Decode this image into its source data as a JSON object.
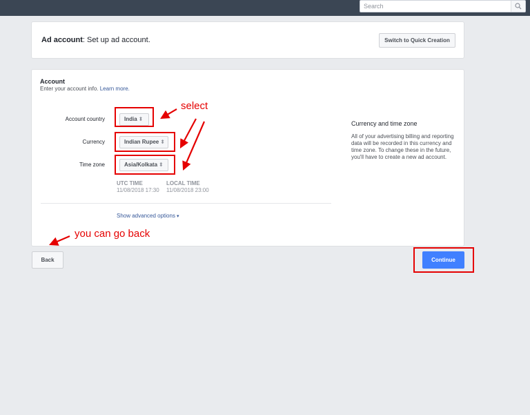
{
  "search": {
    "placeholder": "Search"
  },
  "header": {
    "title_bold": "Ad account",
    "title_rest": ": Set up ad account.",
    "quick_creation_label": "Switch to Quick Creation"
  },
  "account": {
    "title": "Account",
    "subtitle": "Enter your account info.",
    "learn_more": "Learn more.",
    "fields": {
      "country": {
        "label": "Account country",
        "value": "India"
      },
      "currency": {
        "label": "Currency",
        "value": "Indian Rupee"
      },
      "timezone": {
        "label": "Time zone",
        "value": "Asia/Kolkata"
      }
    },
    "utc": {
      "label": "UTC TIME",
      "value": "11/08/2018 17:30"
    },
    "local": {
      "label": "LOCAL TIME",
      "value": "11/08/2018 23:00"
    },
    "advanced_label": "Show advanced options",
    "side_title": "Currency and time zone",
    "side_text": "All of your advertising billing and reporting data will be recorded in this currency and time zone. To change these in the future, you'll have to create a new ad account."
  },
  "footer": {
    "back_label": "Back",
    "continue_label": "Continue"
  },
  "annotations": {
    "select": "select",
    "go_back": "you can go back"
  },
  "colors": {
    "topbar": "#3b4654",
    "primary": "#4080ff",
    "annotation_red": "#e50000",
    "link": "#365899"
  },
  "icons": {
    "search": "magnifier-icon",
    "dropdown": "chevron-updown-icon",
    "advanced_caret": "caret-down-icon"
  }
}
